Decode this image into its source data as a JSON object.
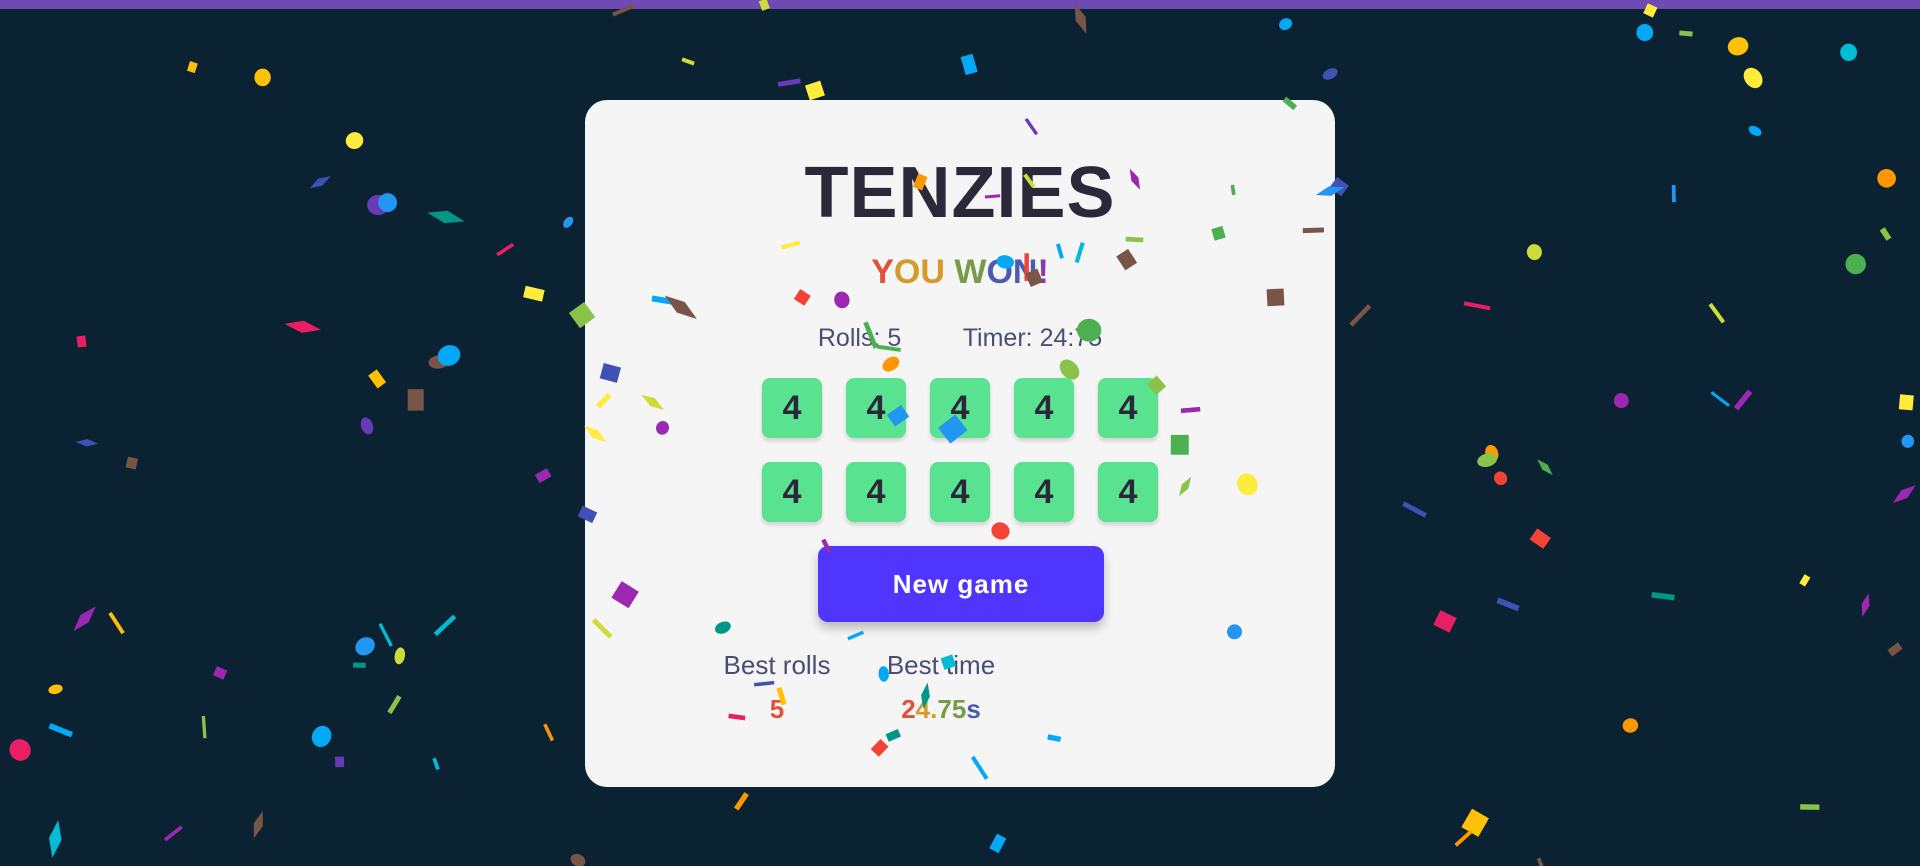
{
  "game": {
    "title": "TENZIES",
    "win_message": "YOU WON!",
    "rolls_label": "Rolls:",
    "rolls_value": "5",
    "timer_label": "Timer:",
    "timer_value": "24:75",
    "dice": [
      "4",
      "4",
      "4",
      "4",
      "4",
      "4",
      "4",
      "4",
      "4",
      "4"
    ],
    "new_game_label": "New game",
    "best_rolls_label": "Best rolls",
    "best_rolls_value": "5",
    "best_time_label": "Best time",
    "best_time_value": "24.75s"
  },
  "colors": {
    "background": "#0b2233",
    "card": "#f5f5f5",
    "die": "#59e391",
    "button": "#5035ff",
    "text_dark": "#2b283a",
    "text_muted": "#4a4e74",
    "top_bar": "#6e4bb3",
    "win_gradient": [
      "#e0513b",
      "#d69a2b",
      "#7a9a4a",
      "#4b5bb0",
      "#8a3ab0"
    ],
    "confetti": [
      "#3f51b5",
      "#673ab7",
      "#9c27b0",
      "#e91e63",
      "#f44336",
      "#ff9800",
      "#ffc107",
      "#ffeb3b",
      "#cddc39",
      "#8bc34a",
      "#4caf50",
      "#009688",
      "#00bcd4",
      "#03a9f4",
      "#2196f3",
      "#795548"
    ]
  }
}
